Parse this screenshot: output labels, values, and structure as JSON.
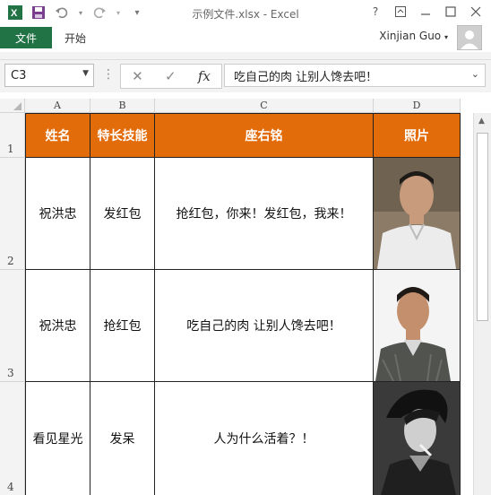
{
  "window": {
    "title": "示例文件.xlsx - Excel",
    "user": "Xinjian Guo"
  },
  "ribbon": {
    "file_tab": "文件",
    "home_tab": "开始"
  },
  "formula_bar": {
    "name_box": "C3",
    "content": "吃自己的肉 让别人馋去吧！"
  },
  "columns": [
    "A",
    "B",
    "C",
    "D"
  ],
  "rows": [
    "1",
    "2",
    "3",
    "4"
  ],
  "table": {
    "headers": [
      "姓名",
      "特长技能",
      "座右铭",
      "照片"
    ],
    "rows": [
      {
        "name": "祝洪忠",
        "skill": "发红包",
        "motto": "抢红包，你来！发红包，我来！"
      },
      {
        "name": "祝洪忠",
        "skill": "抢红包",
        "motto": "吃自己的肉 让别人馋去吧！"
      },
      {
        "name": "看见星光",
        "skill": "发呆",
        "motto": "人为什么活着？！"
      }
    ]
  },
  "colors": {
    "accent": "#217346",
    "header_fill": "#e26b0a"
  }
}
